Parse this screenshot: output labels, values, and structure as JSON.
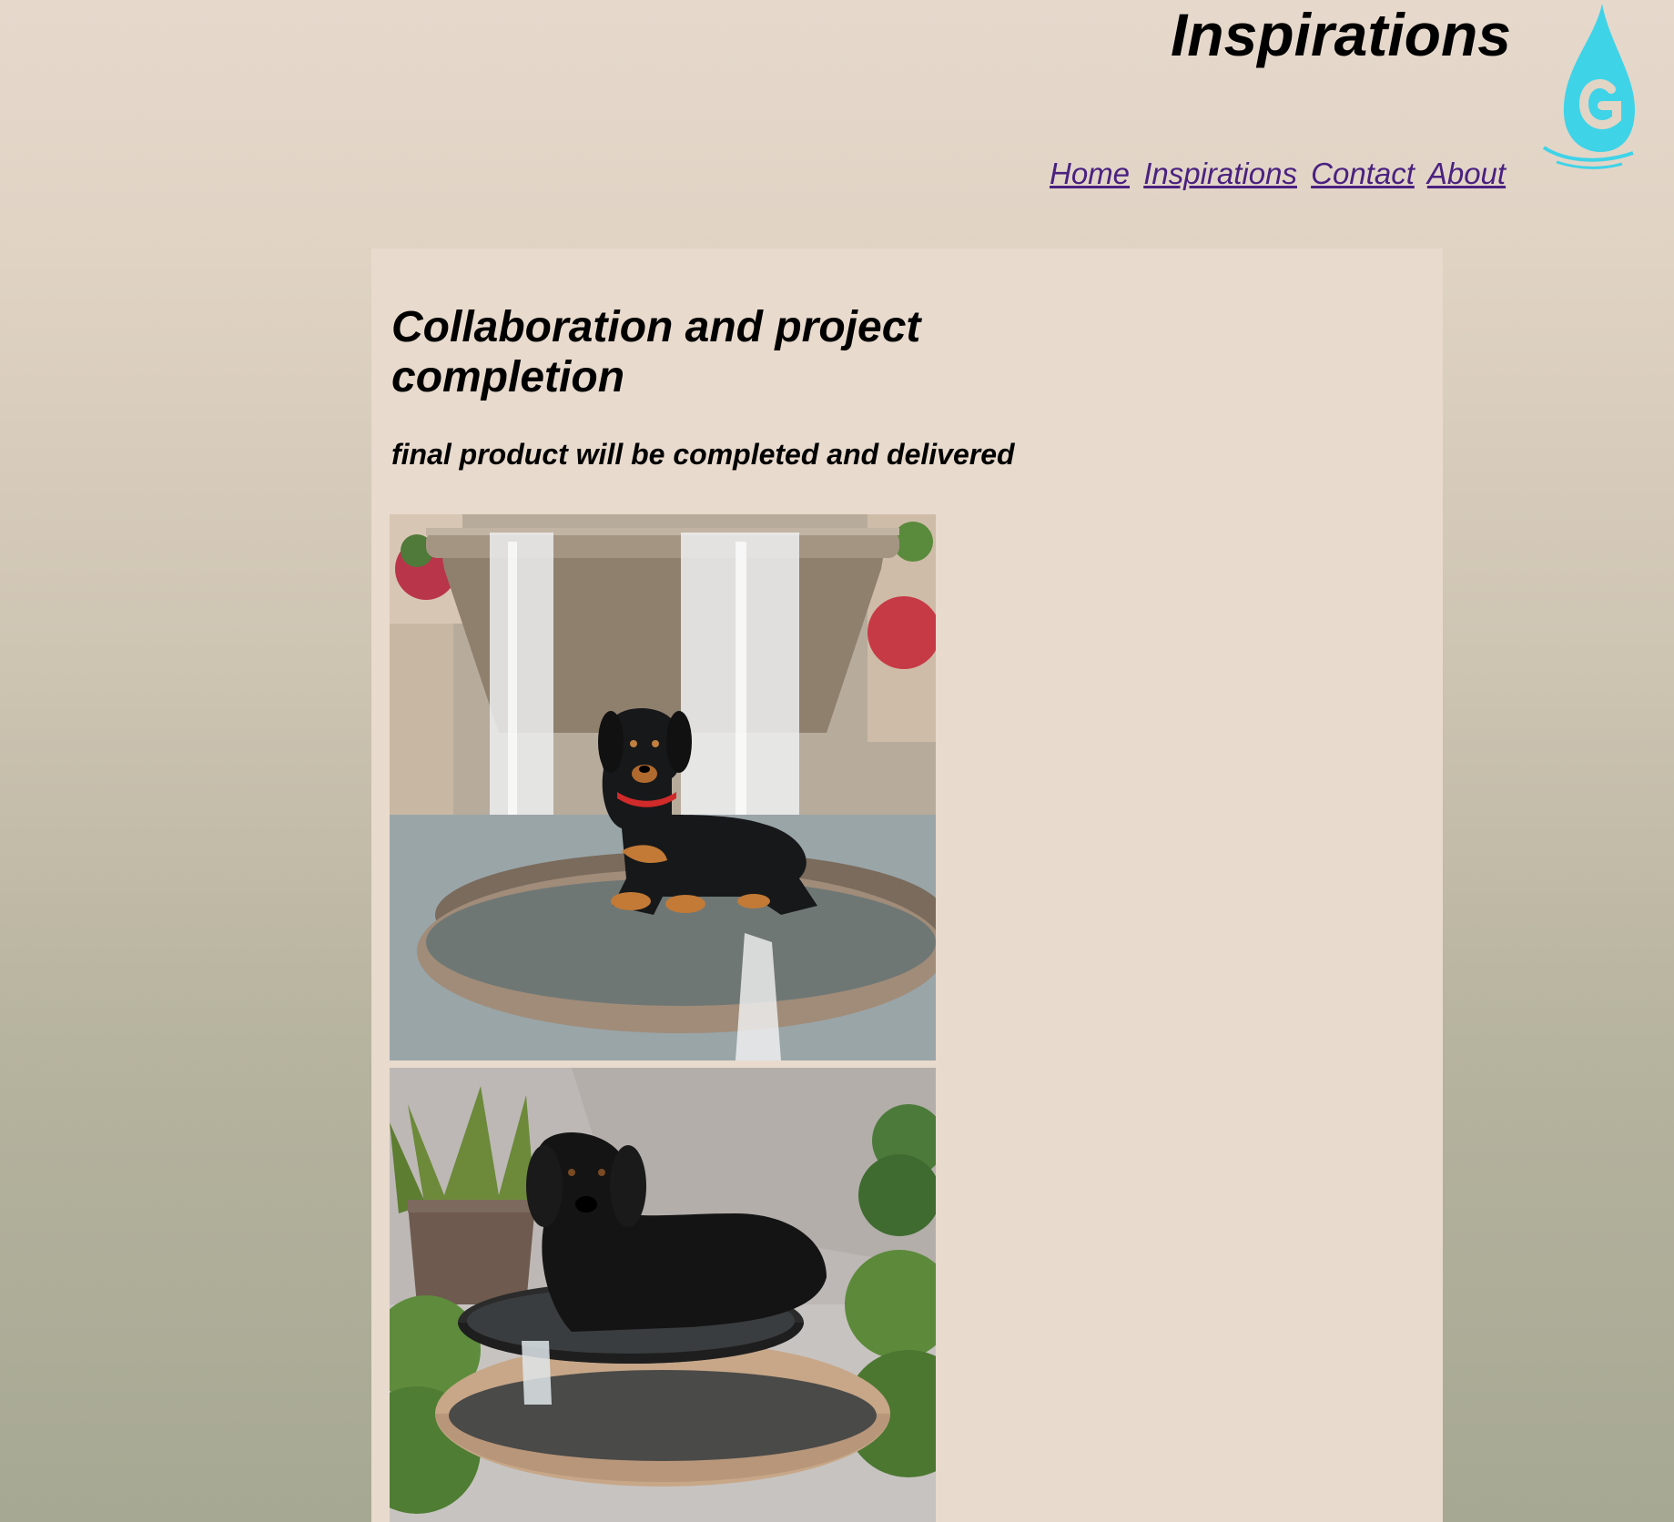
{
  "header": {
    "site_title": "Inspirations",
    "logo_icon": "water-drop-logo-icon",
    "logo_color": "#3fd3e8"
  },
  "nav": {
    "items": [
      {
        "label": "Home"
      },
      {
        "label": "Inspirations"
      },
      {
        "label": "Contact"
      },
      {
        "label": "About"
      }
    ],
    "link_color": "#4a2180"
  },
  "main": {
    "heading": "Collaboration and project completion",
    "subheading": "final product will be completed and delivered",
    "images": [
      {
        "subject": "black-and-tan dachshund lying on a stone fountain basin with cascading water"
      },
      {
        "subject": "black dog lying in a tiered fountain bowl surrounded by shrubs"
      }
    ]
  },
  "colors": {
    "content_panel": "#e8dacd",
    "page_top": "#e6d9cc",
    "page_bottom": "#a6a893"
  }
}
